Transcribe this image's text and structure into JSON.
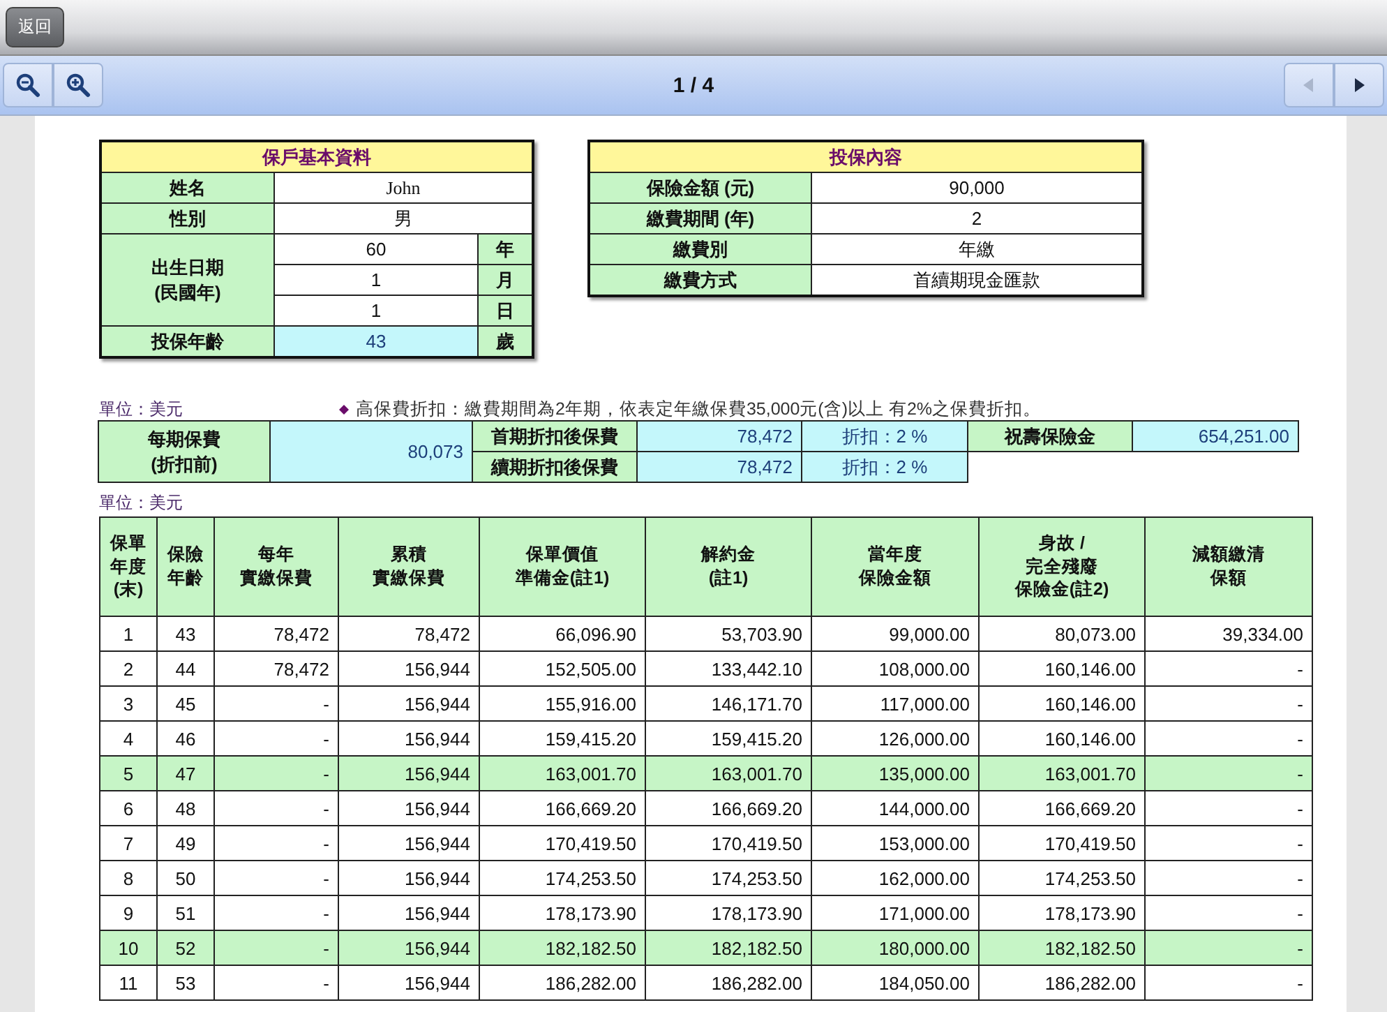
{
  "top_bar": {
    "back_button": "返回"
  },
  "viewer_bar": {
    "page_indicator": "1 / 4",
    "prev_button": {
      "disabled": true
    },
    "next_button": {
      "disabled": false
    }
  },
  "policyholder": {
    "title": "保戶基本資料",
    "name_label": "姓名",
    "name": "John",
    "gender_label": "性別",
    "gender": "男",
    "birth_label": "出生日期\n(民國年)",
    "birth": [
      {
        "value": "60",
        "unit": "年"
      },
      {
        "value": "1",
        "unit": "月"
      },
      {
        "value": "1",
        "unit": "日"
      }
    ],
    "age_label": "投保年齡",
    "age": "43",
    "age_unit": "歲"
  },
  "coverage": {
    "title": "投保內容",
    "rows": [
      {
        "label": "保險金額 (元)",
        "value": "90,000"
      },
      {
        "label": "繳費期間 (年)",
        "value": "2"
      },
      {
        "label": "繳費別",
        "value": "年繳"
      },
      {
        "label": "繳費方式",
        "value": "首續期現金匯款"
      }
    ]
  },
  "premium": {
    "unit": "單位：美元",
    "note": "高保費折扣：繳費期間為2年期，依表定年繳保費35,000元(含)以上 有2%之保費折扣。",
    "base_label": "每期保費\n(折扣前)",
    "base_value": "80,073",
    "first_label": "首期折扣後保費",
    "first_value": "78,472",
    "first_discount": "折扣：2 %",
    "renewal_label": "續期折扣後保費",
    "renewal_value": "78,472",
    "renewal_discount": "折扣：2 %",
    "maturity_label": "祝壽保險金",
    "maturity_value": "654,251.00"
  },
  "table": {
    "unit": "單位：美元",
    "columns": [
      {
        "lines": [
          "保單",
          "年度",
          "(末)"
        ]
      },
      {
        "lines": [
          "保險",
          "年齡"
        ]
      },
      {
        "lines": [
          "每年",
          "實繳保費"
        ]
      },
      {
        "lines": [
          "累積",
          "實繳保費"
        ]
      },
      {
        "lines": [
          "保單價值",
          "準備金(註1)"
        ]
      },
      {
        "lines": [
          "解約金",
          "(註1)"
        ]
      },
      {
        "lines": [
          "當年度",
          "保險金額"
        ]
      },
      {
        "lines": [
          "身故 /",
          "完全殘廢",
          "保險金(註2)"
        ]
      },
      {
        "lines": [
          "減額繳清",
          "保額"
        ]
      }
    ],
    "rows": [
      {
        "highlighted": false,
        "cells": [
          "1",
          "43",
          "78,472",
          "78,472",
          "66,096.90",
          "53,703.90",
          "99,000.00",
          "80,073.00",
          "39,334.00"
        ]
      },
      {
        "highlighted": false,
        "cells": [
          "2",
          "44",
          "78,472",
          "156,944",
          "152,505.00",
          "133,442.10",
          "108,000.00",
          "160,146.00",
          "-"
        ]
      },
      {
        "highlighted": false,
        "cells": [
          "3",
          "45",
          "-",
          "156,944",
          "155,916.00",
          "146,171.70",
          "117,000.00",
          "160,146.00",
          "-"
        ]
      },
      {
        "highlighted": false,
        "cells": [
          "4",
          "46",
          "-",
          "156,944",
          "159,415.20",
          "159,415.20",
          "126,000.00",
          "160,146.00",
          "-"
        ]
      },
      {
        "highlighted": true,
        "cells": [
          "5",
          "47",
          "-",
          "156,944",
          "163,001.70",
          "163,001.70",
          "135,000.00",
          "163,001.70",
          "-"
        ]
      },
      {
        "highlighted": false,
        "cells": [
          "6",
          "48",
          "-",
          "156,944",
          "166,669.20",
          "166,669.20",
          "144,000.00",
          "166,669.20",
          "-"
        ]
      },
      {
        "highlighted": false,
        "cells": [
          "7",
          "49",
          "-",
          "156,944",
          "170,419.50",
          "170,419.50",
          "153,000.00",
          "170,419.50",
          "-"
        ]
      },
      {
        "highlighted": false,
        "cells": [
          "8",
          "50",
          "-",
          "156,944",
          "174,253.50",
          "174,253.50",
          "162,000.00",
          "174,253.50",
          "-"
        ]
      },
      {
        "highlighted": false,
        "cells": [
          "9",
          "51",
          "-",
          "156,944",
          "178,173.90",
          "178,173.90",
          "171,000.00",
          "178,173.90",
          "-"
        ]
      },
      {
        "highlighted": true,
        "cells": [
          "10",
          "52",
          "-",
          "156,944",
          "182,182.50",
          "182,182.50",
          "180,000.00",
          "182,182.50",
          "-"
        ]
      },
      {
        "highlighted": false,
        "cells": [
          "11",
          "53",
          "-",
          "156,944",
          "186,282.00",
          "186,282.00",
          "184,050.00",
          "186,282.00",
          "-"
        ]
      }
    ]
  }
}
